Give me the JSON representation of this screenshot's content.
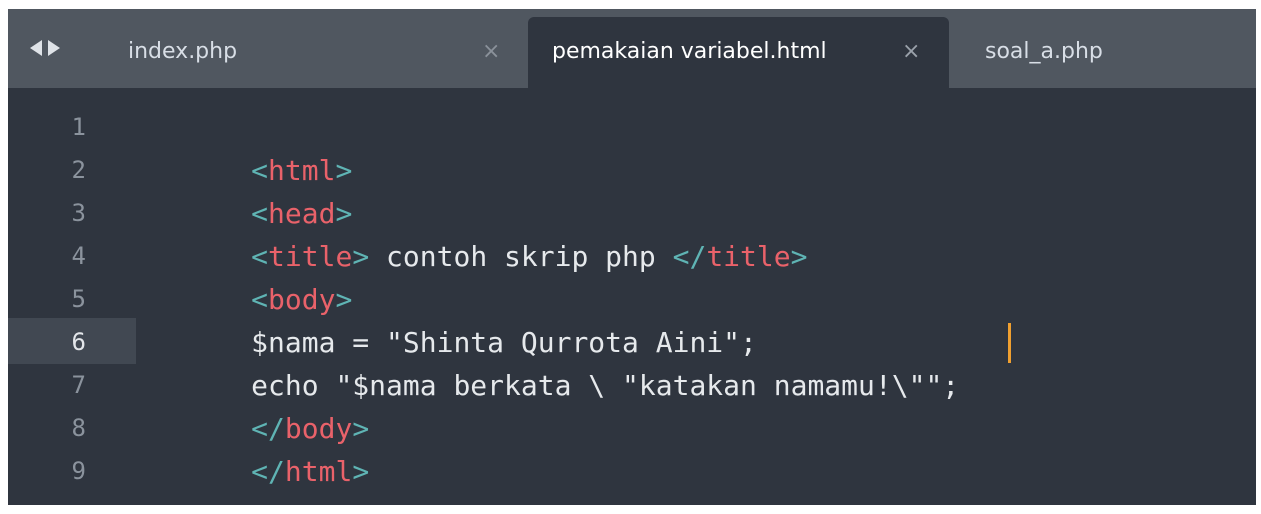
{
  "tabs": [
    {
      "label": "index.php",
      "close": "×"
    },
    {
      "label": "pemakaian variabel.html",
      "close": "×"
    },
    {
      "label": "soal_a.php"
    }
  ],
  "active_tab": 1,
  "line_numbers": [
    "1",
    "2",
    "3",
    "4",
    "5",
    "6",
    "7",
    "8",
    "9"
  ],
  "current_line": 6,
  "code": {
    "l1": {
      "open": "<",
      "tag": "html",
      "close": ">"
    },
    "l2": {
      "open": "<",
      "tag": "head",
      "close": ">"
    },
    "l3": {
      "open": "<",
      "tag": "title",
      "close": ">",
      "text": " contoh skrip php ",
      "open2": "</",
      "tag2": "title",
      "close2": ">"
    },
    "l4": {
      "open": "<",
      "tag": "body",
      "close": ">"
    },
    "l5": {
      "text": "$nama = \"Shinta Qurrota Aini\";"
    },
    "l6": {
      "text": "echo \"$nama berkata \\ \"katakan namamu!\\\"\";"
    },
    "l7": {
      "open": "</",
      "tag": "body",
      "close": ">"
    },
    "l8": {
      "open": "</",
      "tag": "html",
      "close": ">"
    }
  },
  "colors": {
    "editor_bg": "#2f353f",
    "tabbar_bg": "#505760",
    "tag": "#e9626a",
    "punctuation": "#5fb4b4",
    "text": "#e6e9ec",
    "cursor": "#f0a030"
  }
}
